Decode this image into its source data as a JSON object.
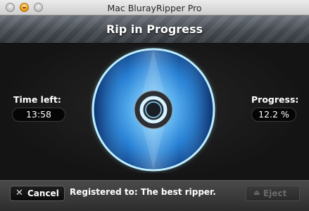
{
  "window": {
    "title": "Mac BlurayRipper Pro"
  },
  "header": {
    "title": "Rip in Progress"
  },
  "status": {
    "time_left_label": "Time left:",
    "time_left_value": "13:58",
    "progress_label": "Progress:",
    "progress_value": "12.2 %"
  },
  "footer": {
    "cancel_label": "Cancel",
    "cancel_icon": "x-icon",
    "registered_text": "Registered to: The best ripper.",
    "eject_label": "Eject",
    "eject_icon": "eject-icon"
  },
  "colors": {
    "disc_blue": "#1e7fd6",
    "disc_glow": "#7fd8ff"
  }
}
